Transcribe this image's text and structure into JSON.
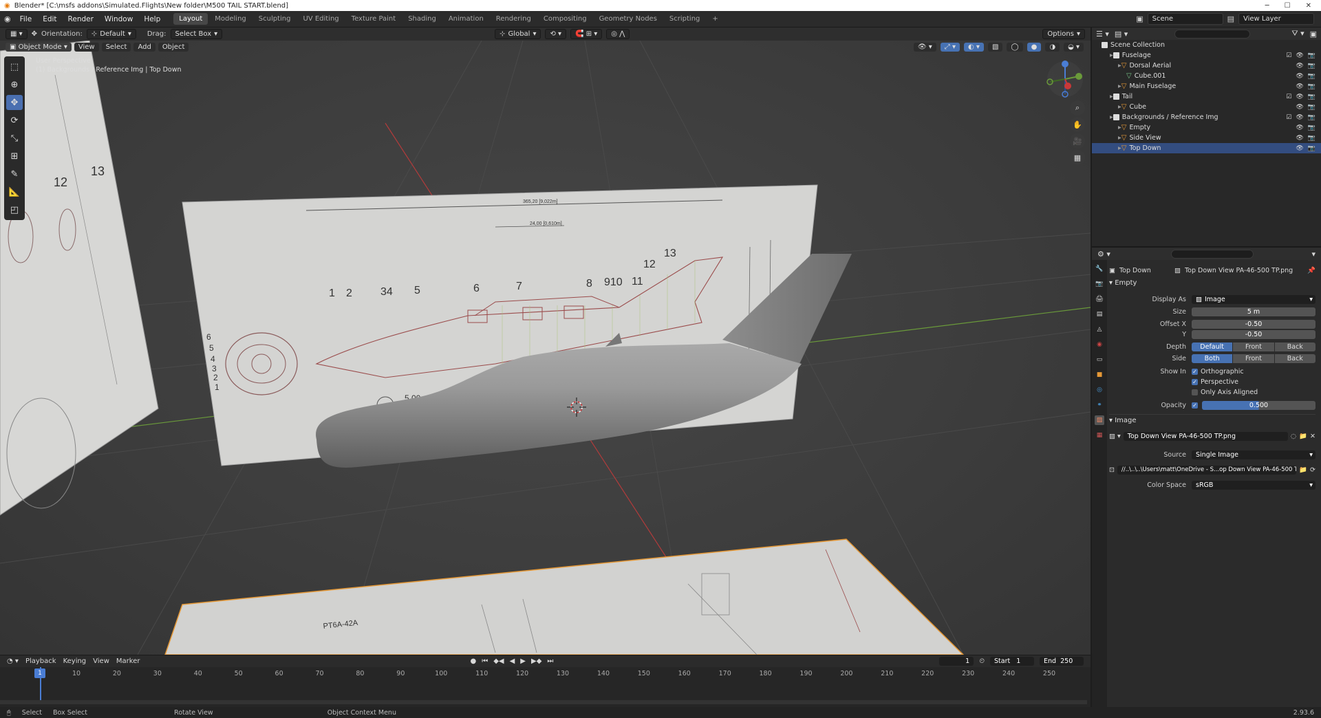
{
  "titlebar": {
    "title": "Blender* [C:\\msfs addons\\Simulated.Flights\\New folder\\M500 TAIL START.blend]"
  },
  "menu": [
    "File",
    "Edit",
    "Render",
    "Window",
    "Help"
  ],
  "workspaces": [
    "Layout",
    "Modeling",
    "Sculpting",
    "UV Editing",
    "Texture Paint",
    "Shading",
    "Animation",
    "Rendering",
    "Compositing",
    "Geometry Nodes",
    "Scripting"
  ],
  "active_workspace": "Layout",
  "scene": "Scene",
  "view_layer": "View Layer",
  "toolheader": {
    "orientation_label": "Orientation:",
    "orientation": "Default",
    "drag_label": "Drag:",
    "drag": "Select Box",
    "transform": "Global",
    "options": "Options"
  },
  "viewport": {
    "mode": "Object Mode",
    "menu": [
      "View",
      "Select",
      "Add",
      "Object"
    ],
    "perspective_line1": "User Perspective",
    "perspective_line2": "(1) Backgrounds / Reference Img | Top Down"
  },
  "outliner": {
    "root": "Scene Collection",
    "rows": [
      {
        "label": "Fuselage",
        "type": "collection",
        "indent": 1
      },
      {
        "label": "Dorsal Aerial",
        "type": "empty",
        "indent": 2
      },
      {
        "label": "Cube.001",
        "type": "mesh",
        "indent": 3
      },
      {
        "label": "Main Fuselage",
        "type": "empty",
        "indent": 2
      },
      {
        "label": "Tail",
        "type": "collection",
        "indent": 1
      },
      {
        "label": "Cube",
        "type": "empty",
        "indent": 2
      },
      {
        "label": "Backgrounds / Reference Img",
        "type": "collection",
        "indent": 1
      },
      {
        "label": "Empty",
        "type": "empty",
        "indent": 2
      },
      {
        "label": "Side View",
        "type": "empty",
        "indent": 2
      },
      {
        "label": "Top Down",
        "type": "empty",
        "indent": 2,
        "selected": true
      }
    ]
  },
  "properties": {
    "object_name": "Top Down",
    "data_name": "Top Down View PA-46-500 TP.png",
    "empty_panel": "Empty",
    "display_as_label": "Display As",
    "display_as": "Image",
    "size_label": "Size",
    "size": "5 m",
    "offset_x_label": "Offset X",
    "offset_x": "-0.50",
    "offset_y_label": "Y",
    "offset_y": "-0.50",
    "depth_label": "Depth",
    "depth_options": [
      "Default",
      "Front",
      "Back"
    ],
    "side_label": "Side",
    "side_options": [
      "Both",
      "Front",
      "Back"
    ],
    "show_in_label": "Show In",
    "show_orthographic": "Orthographic",
    "show_perspective": "Perspective",
    "only_axis_aligned": "Only Axis Aligned",
    "opacity_label": "Opacity",
    "opacity": "0.500",
    "image_panel": "Image",
    "image_name": "Top Down View PA-46-500 TP.png",
    "source_label": "Source",
    "source": "Single Image",
    "filepath": "//..\\..\\..\\Users\\matt\\OneDrive - S...op Down View PA-46-500 TP.png",
    "color_space_label": "Color Space",
    "color_space": "sRGB"
  },
  "timeline": {
    "menu": [
      "Playback",
      "Keying",
      "View",
      "Marker"
    ],
    "current_frame": "1",
    "start_label": "Start",
    "start": "1",
    "end_label": "End",
    "end": "250",
    "ticks": [
      "10",
      "20",
      "30",
      "40",
      "50",
      "60",
      "70",
      "80",
      "90",
      "100",
      "110",
      "120",
      "130",
      "140",
      "150",
      "160",
      "170",
      "180",
      "190",
      "200",
      "210",
      "220",
      "230",
      "240",
      "250"
    ]
  },
  "statusbar": {
    "select": "Select",
    "box_select": "Box Select",
    "rotate_view": "Rotate View",
    "context_menu": "Object Context Menu",
    "version": "2.93.6"
  },
  "blueprint": {
    "numbers": [
      "1",
      "2",
      "34",
      "5",
      "6",
      "7",
      "8",
      "910",
      "11",
      "12",
      "13"
    ],
    "front_numbers": [
      "6",
      "5",
      "4",
      "3",
      "2",
      "1"
    ],
    "dim_top": "365,20 [9,022m]",
    "dim_mid": "24,00 [0,610m]",
    "dim_small": "5,00 x 5",
    "floor_label": "PT6A-42A",
    "side_numbers": [
      "12",
      "13"
    ]
  },
  "colors": {
    "accent": "#4772b3",
    "selected_row": "#334d80",
    "viewport_bg": "#3d3d3d"
  }
}
